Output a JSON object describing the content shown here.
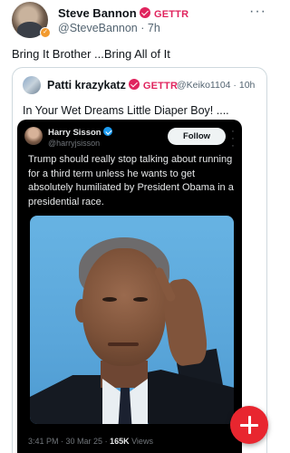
{
  "post": {
    "author_name": "Steve Bannon",
    "source": "GETTR",
    "handle": "@SteveBannon",
    "time": "7h",
    "more_icon": "ellipsis-icon",
    "text": "Bring It Brother ...Bring All of It"
  },
  "quote": {
    "author_name": "Patti krazykatz",
    "source": "GETTR",
    "handle": "@Keiko1104",
    "time": "10h",
    "text": "In Your Wet Dreams Little Diaper Boy! ...."
  },
  "embed": {
    "author_name": "Harry Sisson",
    "handle": "@harryjsisson",
    "follow_label": "Follow",
    "text": "Trump should really stop talking about running for a third term unless he wants to get absolutely humiliated by President Obama in a presidential race.",
    "time": "3:41 PM",
    "date": "30 Mar 25",
    "views_count": "165K",
    "views_label": "Views"
  },
  "fab": {
    "icon": "plus-icon"
  },
  "colors": {
    "accent_red": "#e8262f",
    "verified_red": "#e0245e",
    "verified_blue": "#1d9bf0"
  }
}
